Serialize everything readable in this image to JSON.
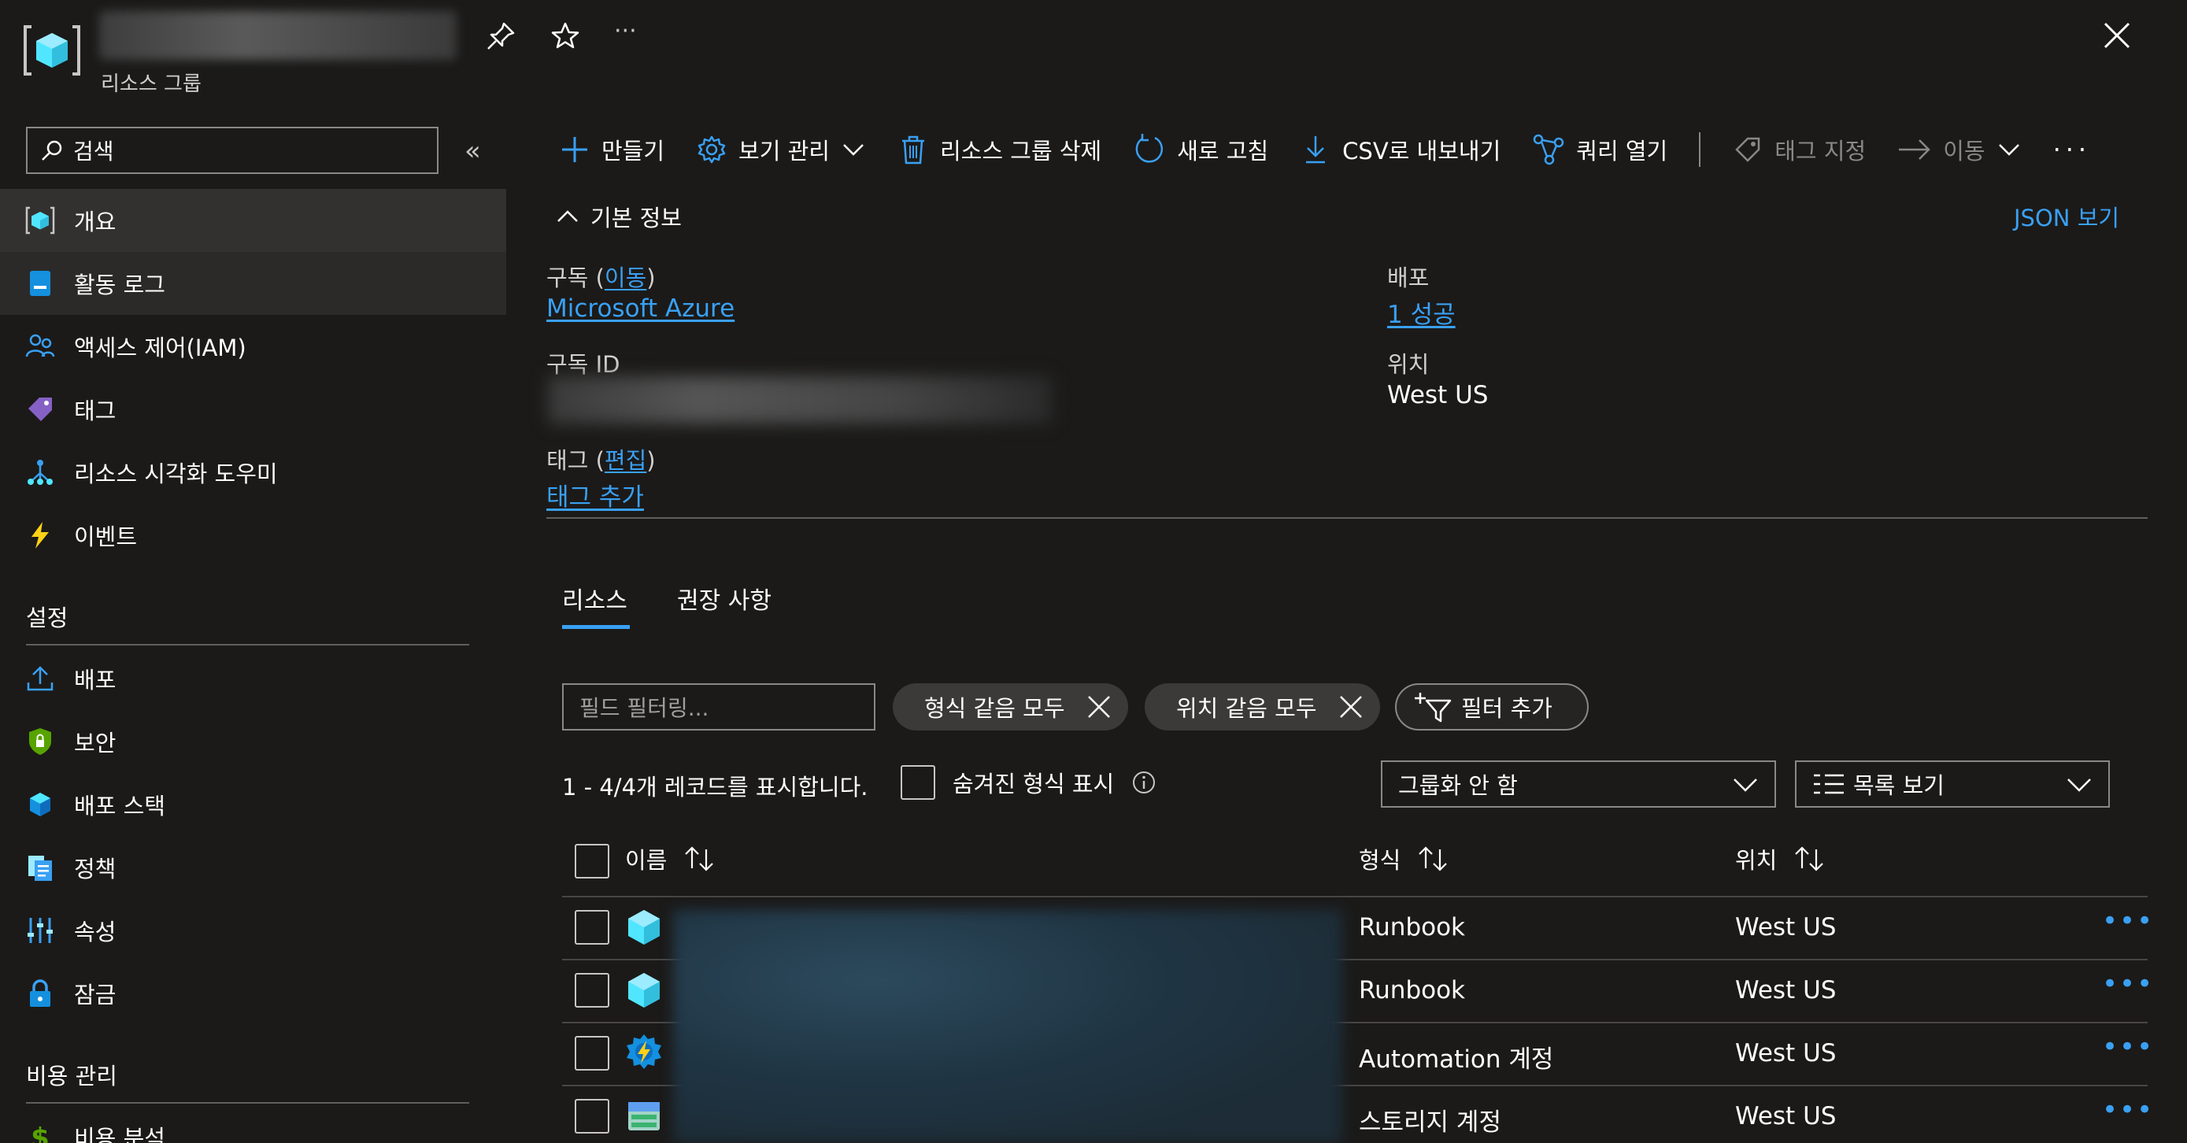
{
  "header": {
    "subtitle": "리소스 그룹"
  },
  "sidebar": {
    "search_placeholder": "검색",
    "items": [
      {
        "label": "개요"
      },
      {
        "label": "활동 로그"
      },
      {
        "label": "액세스 제어(IAM)"
      },
      {
        "label": "태그"
      },
      {
        "label": "리소스 시각화 도우미"
      },
      {
        "label": "이벤트"
      }
    ],
    "sections": [
      {
        "title": "설정",
        "items": [
          {
            "label": "배포"
          },
          {
            "label": "보안"
          },
          {
            "label": "배포 스택"
          },
          {
            "label": "정책"
          },
          {
            "label": "속성"
          },
          {
            "label": "잠금"
          }
        ]
      },
      {
        "title": "비용 관리",
        "items": [
          {
            "label": "비용 분석"
          }
        ]
      }
    ]
  },
  "toolbar": {
    "create": "만들기",
    "manage_view": "보기 관리",
    "delete_group": "리소스 그룹 삭제",
    "refresh": "새로 고침",
    "export_csv": "CSV로 내보내기",
    "open_query": "쿼리 열기",
    "assign_tags": "태그 지정",
    "move": "이동"
  },
  "essentials": {
    "title": "기본 정보",
    "json_view": "JSON 보기",
    "subscription_label": "구독",
    "subscription_move": "이동",
    "subscription_value": "Microsoft Azure",
    "subscription_id_label": "구독 ID",
    "tags_label": "태그",
    "tags_edit": "편집",
    "tags_add": "태그 추가",
    "deployment_label": "배포",
    "deployment_value": "1 성공",
    "location_label": "위치",
    "location_value": "West US"
  },
  "tabs": [
    {
      "label": "리소스"
    },
    {
      "label": "권장 사항"
    }
  ],
  "filters": {
    "field_placeholder": "필드 필터링...",
    "type_pill": "형식 같음 모두",
    "location_pill": "위치 같음 모두",
    "add_filter": "필터 추가"
  },
  "records_text": "1 - 4/4개 레코드를 표시합니다.",
  "show_hidden": "숨겨진 형식 표시",
  "group_by": "그룹화 안 함",
  "view_mode": "목록 보기",
  "table": {
    "headers": {
      "name": "이름",
      "type": "형식",
      "location": "위치"
    },
    "rows": [
      {
        "type": "Runbook",
        "location": "West US",
        "icon": "runbook-icon"
      },
      {
        "type": "Runbook",
        "location": "West US",
        "icon": "runbook-icon"
      },
      {
        "type": "Automation 계정",
        "location": "West US",
        "icon": "automation-account-icon"
      },
      {
        "type": "스토리지 계정",
        "location": "West US",
        "icon": "storage-account-icon"
      }
    ]
  },
  "colors": {
    "accent": "#3aa0f3",
    "background": "#1b1a19",
    "selected": "#323130"
  }
}
